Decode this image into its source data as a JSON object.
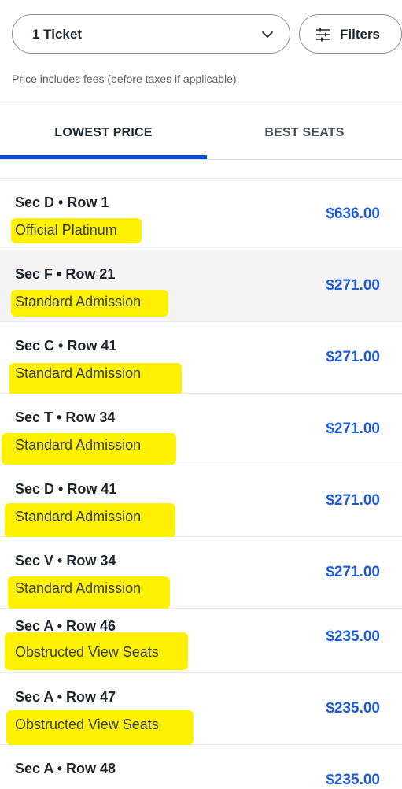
{
  "header": {
    "ticket_quantity": "1 Ticket",
    "filters_label": "Filters",
    "fee_note": "Price includes fees (before taxes if applicable)."
  },
  "tabs": [
    {
      "label": "LOWEST PRICE",
      "active": true
    },
    {
      "label": "BEST SEATS",
      "active": false
    }
  ],
  "colors": {
    "accent": "#024ddf",
    "price": "#1f5bd8",
    "highlight": "#fff200"
  },
  "listings": [
    {
      "seat": "Sec D • Row 1",
      "type": "Official Platinum",
      "price": "$636.00"
    },
    {
      "seat": "Sec F • Row 21",
      "type": "Standard Admission",
      "price": "$271.00"
    },
    {
      "seat": "Sec C • Row 41",
      "type": "Standard Admission",
      "price": "$271.00"
    },
    {
      "seat": "Sec T • Row 34",
      "type": "Standard Admission",
      "price": "$271.00"
    },
    {
      "seat": "Sec D • Row 41",
      "type": "Standard Admission",
      "price": "$271.00"
    },
    {
      "seat": "Sec V • Row 34",
      "type": "Standard Admission",
      "price": "$271.00"
    },
    {
      "seat": "Sec A • Row 46",
      "type": "Obstructed View Seats",
      "price": "$235.00"
    },
    {
      "seat": "Sec A • Row 47",
      "type": "Obstructed View Seats",
      "price": "$235.00"
    },
    {
      "seat": "Sec A • Row 48",
      "type": "",
      "price": "$235.00"
    }
  ],
  "icons": {
    "dropdown": "chevron-down-icon",
    "filters": "sliders-icon"
  }
}
